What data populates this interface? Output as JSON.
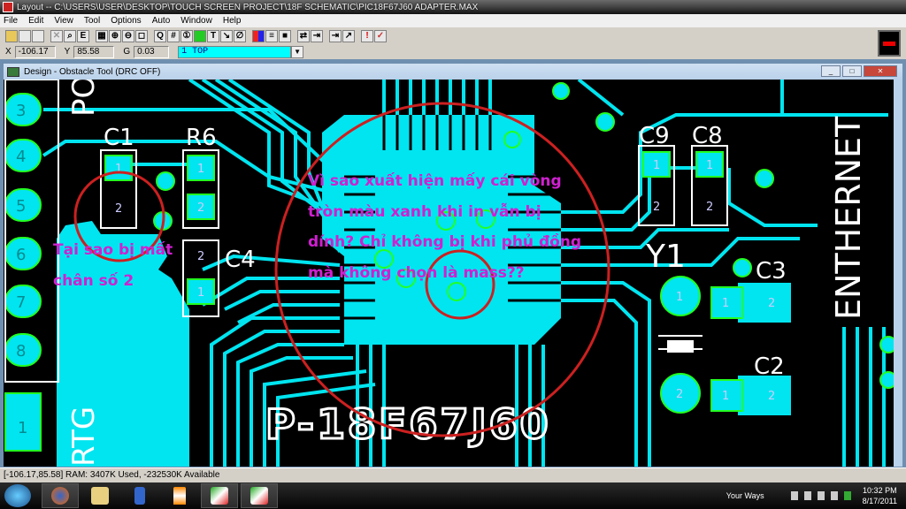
{
  "window": {
    "title": "Layout -- C:\\USERS\\USER\\DESKTOP\\TOUCH SCREEN PROJECT\\18F SCHEMATIC\\PIC18F67J60 ADAPTER.MAX"
  },
  "menu": [
    "File",
    "Edit",
    "View",
    "Tool",
    "Options",
    "Auto",
    "Window",
    "Help"
  ],
  "toolbar": {
    "icons": [
      "open-icon",
      "save-icon",
      "library-icon",
      "delete-icon",
      "find-icon",
      "edit-icon",
      "spreadsheet-icon",
      "zoom-in-icon",
      "zoom-out-icon",
      "zoom-all-icon",
      "query-icon",
      "grid-icon",
      "pin-icon",
      "obstacle-icon",
      "text-icon",
      "connection-icon",
      "error-icon",
      "color-icon",
      "drc-icon",
      "component-icon",
      "reconnect-icon",
      "autoroute-icon",
      "shove-icon",
      "route-icon",
      "drc-error-icon",
      "check-icon"
    ],
    "text_glyphs": {
      "edit": "E",
      "text": "T",
      "query": "Q"
    }
  },
  "coords": {
    "x_label": "X",
    "x": "-106.17",
    "y_label": "Y",
    "y": "85.58",
    "g_label": "G",
    "g": "0.03",
    "layer": "1 TOP"
  },
  "child_window": {
    "title": "Design - Obstacle Tool (DRC OFF)"
  },
  "pcb": {
    "connector_pins": [
      "3",
      "4",
      "5",
      "6",
      "7",
      "8"
    ],
    "connector_pad_1": "1",
    "silk_labels": {
      "c1": "C1",
      "r6": "R6",
      "c4": "C4",
      "c9": "C9",
      "c8": "C8",
      "c3": "C3",
      "c2": "C2",
      "y1": "Y1",
      "po": "PO",
      "rtg": "RTG",
      "ethernet": "ENTHERNET",
      "chip": "P-18F67J60"
    },
    "pad_numbers": {
      "one": "1",
      "two": "2"
    },
    "colors": {
      "copper": "#00e5f0",
      "pad_ring": "#22ff22",
      "silk": "#ffffff",
      "annotation": "#d020d0",
      "marker": "#cc2020"
    }
  },
  "annotations": {
    "left": [
      "Tại sao bị mất",
      "chân số 2"
    ],
    "center": [
      "Vì sao xuất hiện mấy cái vòng",
      "tròn màu xanh khi in vẫn bị",
      "dính? Chỉ không bị khi phủ đồng",
      "mà không chọn là mass??"
    ]
  },
  "status": {
    "text": "[-106.17,85.58]   RAM: 3407K Used, -232530K Available"
  },
  "taskbar": {
    "tray_label": "Your Ways",
    "time": "10:32 PM",
    "date": "8/17/2011"
  }
}
